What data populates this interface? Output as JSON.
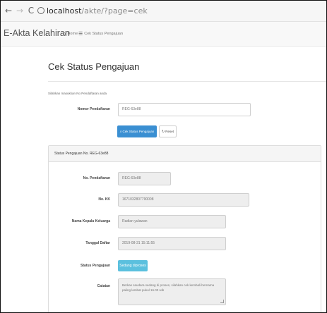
{
  "browser": {
    "back_icon": "arrow-left-icon",
    "forward_icon": "arrow-right-icon",
    "reload_icon": "reload-icon",
    "url_host": "localhost",
    "url_path": "/akte/?page=cek"
  },
  "navbar": {
    "brand": "E-Akta Kelahiran",
    "items": [
      {
        "icon": "home-icon",
        "label": "Home"
      },
      {
        "icon": "list-icon",
        "label": "Cek Status Pengajuan"
      }
    ]
  },
  "page": {
    "title": "Cek Status Pengajuan",
    "hint": "Silahkan masukkan No Pendaftaran anda",
    "form": {
      "nomor_label": "Nomor Pendaftaran",
      "nomor_value": "REG-63e88",
      "submit_label": "Cek Status Pengajuan",
      "submit_icon": "search-icon",
      "reset_label": "Reset",
      "reset_icon": "refresh-icon"
    }
  },
  "result": {
    "heading": "Status Pengajuan No. REG-63e88",
    "fields": {
      "no_pendaftaran_label": "No. Pendaftaran",
      "no_pendaftaran_value": "REG-63e88",
      "no_kk_label": "No. KK",
      "no_kk_value": "1671032807790008",
      "kepala_keluarga_label": "Nama Kepala Keluarga",
      "kepala_keluarga_value": "Radian yulawan",
      "tanggal_daftar_label": "Tanggal Daftar",
      "tanggal_daftar_value": "2019-08-31 15:11:55",
      "status_label": "Status Pengajuan",
      "status_value": "Sedang diproses",
      "catatan_label": "Catatan",
      "catatan_value": "Berkas saudara sedang di proses, silahkan cek kembali bernama paling lambat pukul 16.00 wib"
    },
    "status_color": "#5bc0de"
  },
  "colors": {
    "primary": "#3a8fd2",
    "navbar_bg": "#f8f8f8"
  }
}
